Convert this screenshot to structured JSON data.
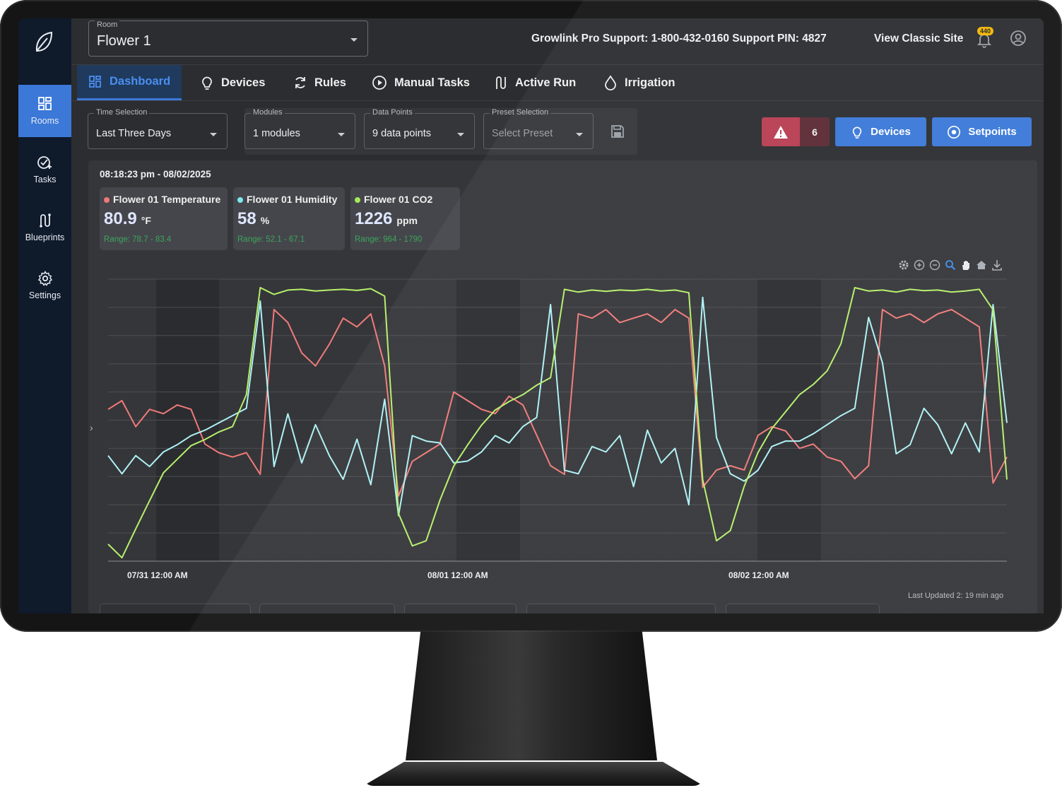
{
  "room": {
    "label": "Room",
    "value": "Flower 1"
  },
  "header": {
    "support_text": "Growlink Pro Support: 1-800-432-0160  Support PIN: 4827",
    "classic_link": "View Classic Site",
    "notification_count": "440"
  },
  "sidebar": {
    "items": [
      {
        "label": "Rooms",
        "icon": "rooms-grid-icon",
        "active": true
      },
      {
        "label": "Tasks",
        "icon": "tasks-check-icon",
        "active": false
      },
      {
        "label": "Blueprints",
        "icon": "blueprints-icon",
        "active": false
      },
      {
        "label": "Settings",
        "icon": "gear-icon",
        "active": false
      }
    ]
  },
  "tabs": [
    {
      "label": "Dashboard",
      "icon": "dashboard-icon",
      "active": true
    },
    {
      "label": "Devices",
      "icon": "bulb-icon"
    },
    {
      "label": "Rules",
      "icon": "refresh-icon"
    },
    {
      "label": "Manual Tasks",
      "icon": "play-circle-icon"
    },
    {
      "label": "Active Run",
      "icon": "run-icon"
    },
    {
      "label": "Irrigation",
      "icon": "water-drop-icon"
    }
  ],
  "filters": {
    "time": {
      "label": "Time Selection",
      "value": "Last Three Days"
    },
    "modules": {
      "label": "Modules",
      "value": "1 modules"
    },
    "data_points": {
      "label": "Data Points",
      "value": "9 data points"
    },
    "preset": {
      "label": "Preset Selection",
      "placeholder": "Select Preset"
    }
  },
  "actions": {
    "alerts_count": "6",
    "devices_label": "Devices",
    "setpoints_label": "Setpoints"
  },
  "colors": {
    "accent": "#3b78d8",
    "alert": "#b83d52",
    "temperature": "#f07a78",
    "humidity": "#aef2f5",
    "co2": "#b6f06a",
    "range_green": "#3ba55c"
  },
  "timestamp": "08:18:23 pm - 08/02/2025",
  "stats": [
    {
      "name": "Flower 01 Temperature",
      "value": "80.9",
      "unit": "°F",
      "range": "Range: 78.7 - 83.4",
      "color": "#f07a78"
    },
    {
      "name": "Flower 01 Humidity",
      "value": "58",
      "unit": "%",
      "range": "Range: 52.1 - 67.1",
      "color": "#7ee8f0"
    },
    {
      "name": "Flower 01 CO2",
      "value": "1226",
      "unit": "ppm",
      "range": "Range: 964 - 1790",
      "color": "#a6e85a"
    }
  ],
  "chart_data": {
    "type": "line",
    "x_ticks": [
      "07/31 12:00 AM",
      "08/01 12:00 AM",
      "08/02 12:00 AM"
    ],
    "grid": true,
    "legend": "none",
    "series": [
      {
        "name": "Flower 01 Temperature",
        "color": "#f07a78",
        "values": [
          81.0,
          81.2,
          80.6,
          81.0,
          80.9,
          81.1,
          81.0,
          80.2,
          80.0,
          79.9,
          80.0,
          79.5,
          83.3,
          83.0,
          82.3,
          82.0,
          82.5,
          83.1,
          82.9,
          83.2,
          82.0,
          79.0,
          79.8,
          80.0,
          80.2,
          81.4,
          81.2,
          81.0,
          80.9,
          81.3,
          81.1,
          80.4,
          79.7,
          79.5,
          83.2,
          83.1,
          83.3,
          83.0,
          83.1,
          83.2,
          83.0,
          83.3,
          83.1,
          79.2,
          79.6,
          79.7,
          79.6,
          80.4,
          80.6,
          80.5,
          80.1,
          80.2,
          79.9,
          79.8,
          79.4,
          79.7,
          83.3,
          83.1,
          83.2,
          83.0,
          83.2,
          83.3,
          83.1,
          82.9,
          79.3,
          79.9
        ]
      },
      {
        "name": "Flower 01 Humidity",
        "color": "#aef2f5",
        "values": [
          57.8,
          56.8,
          57.8,
          57.2,
          58.0,
          58.4,
          58.9,
          59.2,
          59.6,
          60.0,
          60.4,
          66.3,
          57.2,
          60.1,
          57.4,
          59.5,
          57.8,
          56.5,
          58.7,
          56.2,
          60.9,
          54.5,
          58.9,
          58.6,
          58.5,
          57.4,
          57.5,
          58.0,
          58.9,
          58.5,
          59.4,
          59.9,
          66.1,
          57.0,
          56.8,
          58.3,
          58.0,
          58.9,
          56.1,
          59.2,
          57.4,
          58.2,
          55.1,
          66.5,
          58.8,
          56.8,
          56.4,
          57.0,
          58.3,
          58.6,
          58.6,
          59.0,
          59.5,
          60.0,
          60.4,
          65.4,
          62.9,
          57.9,
          58.4,
          60.4,
          59.5,
          57.9,
          59.6,
          58.0,
          66.1,
          59.6
        ]
      },
      {
        "name": "Flower 01 CO2",
        "color": "#b6f06a",
        "values": [
          1010,
          970,
          1055,
          1138,
          1220,
          1260,
          1300,
          1318,
          1340,
          1356,
          1450,
          1765,
          1745,
          1758,
          1760,
          1755,
          1758,
          1760,
          1757,
          1762,
          1740,
          1100,
          1005,
          1020,
          1140,
          1240,
          1302,
          1360,
          1405,
          1430,
          1450,
          1478,
          1500,
          1760,
          1752,
          1758,
          1754,
          1758,
          1756,
          1760,
          1755,
          1758,
          1750,
          1200,
          1020,
          1050,
          1180,
          1280,
          1350,
          1400,
          1450,
          1480,
          1520,
          1600,
          1765,
          1755,
          1758,
          1752,
          1760,
          1756,
          1758,
          1752,
          1755,
          1760,
          1700,
          1200
        ]
      }
    ]
  },
  "last_updated": "Last Updated 2: 19 min ago"
}
